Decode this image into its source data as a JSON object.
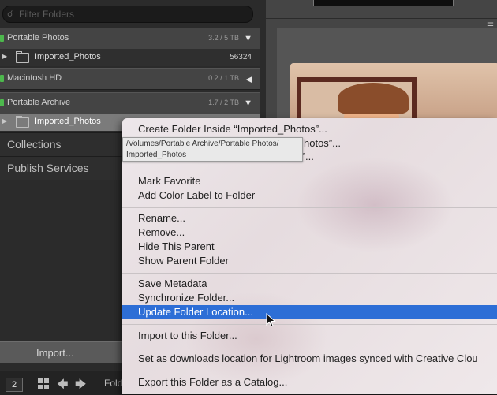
{
  "search": {
    "placeholder": "Filter Folders"
  },
  "volumes": [
    {
      "name": "Portable Photos",
      "size": "3.2 / 5 TB",
      "toggle": "▼",
      "led_color": "#4db84d"
    },
    {
      "name": "Macintosh HD",
      "size": "0.2 / 1 TB",
      "toggle": "◀",
      "led_color": "#4db84d"
    },
    {
      "name": "Portable Archive",
      "size": "1.7 / 2 TB",
      "toggle": "▼",
      "led_color": "#4db84d"
    }
  ],
  "folders": [
    {
      "name": "Imported_Photos",
      "count": "56324"
    },
    {
      "name": "Imported_Photos",
      "count": ""
    }
  ],
  "sections": {
    "collections": "Collections",
    "publish_services": "Publish Services"
  },
  "import_button": "Import...",
  "bottom_bar": {
    "page": "2",
    "folder_label": "Folde"
  },
  "tooltip": {
    "line1": "/Volumes/Portable Archive/Portable Photos/",
    "line2": "Imported_Photos"
  },
  "menu": {
    "groups": [
      [
        "Create Folder Inside “Imported_Photos”...",
        "Create Folder Inside “Imported_Photos”...",
        "Create Folder Inside “Imported_Photos”..."
      ],
      [
        "Mark Favorite",
        "Add Color Label to Folder"
      ],
      [
        "Rename...",
        "Remove...",
        "Hide This Parent",
        "Show Parent Folder"
      ],
      [
        "Save Metadata",
        "Synchronize Folder...",
        "Update Folder Location..."
      ],
      [
        "Import to this Folder..."
      ],
      [
        "Set as downloads location for Lightroom images synced with Creative Clou"
      ],
      [
        "Export this Folder as a Catalog..."
      ]
    ],
    "highlighted": "Update Folder Location...",
    "highlight_color": "#2d6ed6"
  },
  "menu_items": {
    "create_folder": "Create Folder Inside “Imported_Photos”...",
    "create_folder_2": "hotos”...",
    "create_folder_3": "_Photos”...",
    "mark_favorite": "Mark Favorite",
    "add_color_label": "Add Color Label to Folder",
    "rename": "Rename...",
    "remove": "Remove...",
    "hide_parent": "Hide This Parent",
    "show_parent": "Show Parent Folder",
    "save_metadata": "Save Metadata",
    "synchronize": "Synchronize Folder...",
    "update_location": "Update Folder Location...",
    "import_to_folder": "Import to this Folder...",
    "set_downloads": "Set as downloads location for Lightroom images synced with Creative Clou",
    "export_catalog": "Export this Folder as a Catalog..."
  }
}
